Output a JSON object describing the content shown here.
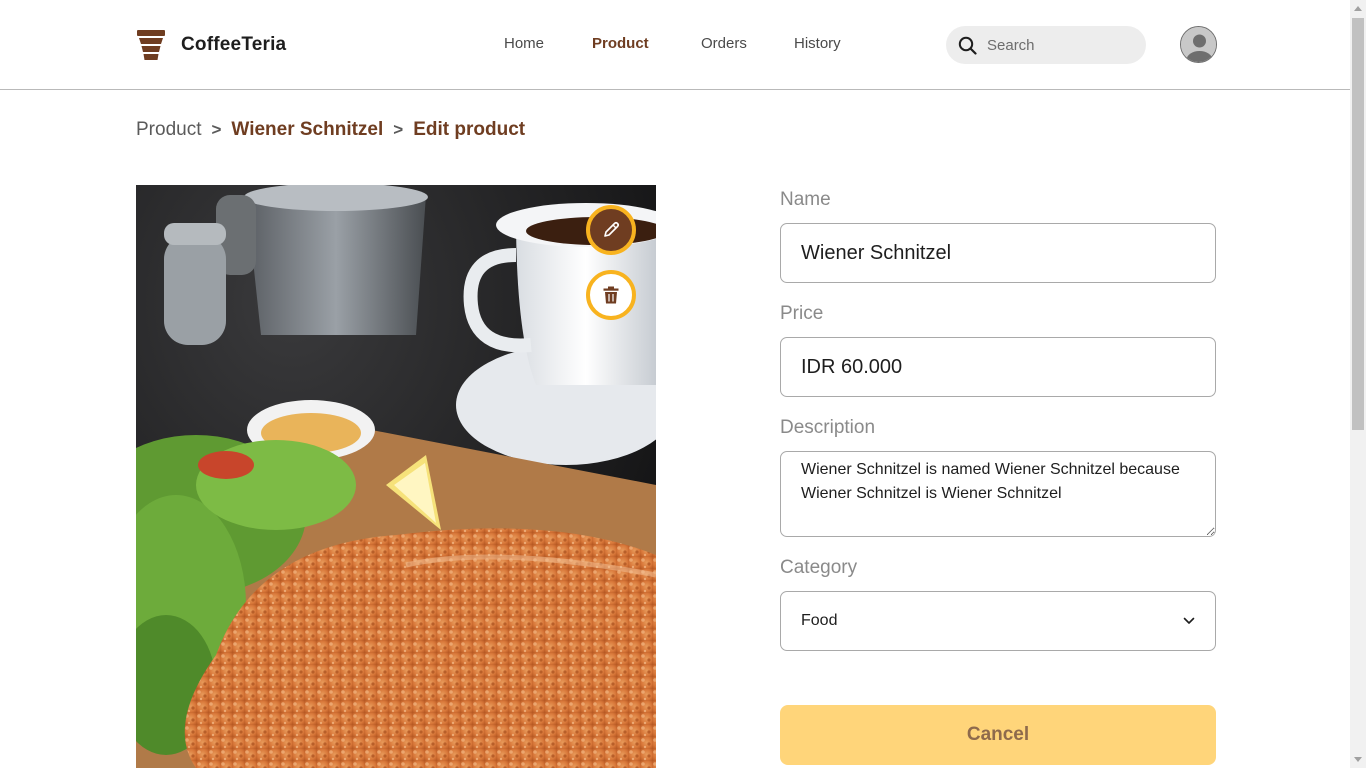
{
  "brand": {
    "name": "CoffeeTeria",
    "logo_icon": "coffee-cup-icon"
  },
  "nav": {
    "items": [
      {
        "label": "Home",
        "active": false
      },
      {
        "label": "Product",
        "active": true
      },
      {
        "label": "Orders",
        "active": false
      },
      {
        "label": "History",
        "active": false
      }
    ]
  },
  "search": {
    "placeholder": "Search",
    "value": "",
    "icon": "search-icon"
  },
  "user": {
    "icon": "user-avatar-icon"
  },
  "breadcrumb": {
    "root": "Product",
    "item": "Wiener Schnitzel",
    "current": "Edit product",
    "separator": ">"
  },
  "image": {
    "edit_icon": "pencil-icon",
    "delete_icon": "trash-icon"
  },
  "form": {
    "name_label": "Name",
    "name_value": "Wiener Schnitzel",
    "price_label": "Price",
    "price_value": "IDR 60.000",
    "description_label": "Description",
    "description_value": "Wiener Schnitzel is named Wiener Schnitzel because Wiener Schnitzel is Wiener Schnitzel",
    "category_label": "Category",
    "category_value": "Food",
    "category_options": [
      "Food"
    ],
    "cancel_label": "Cancel"
  },
  "colors": {
    "brand_brown": "#6f3d21",
    "accent_yellow": "#f8b31f",
    "cancel_bg": "#ffd57a",
    "cancel_text": "#8e6a4c",
    "label_gray": "#8a8a8a"
  }
}
